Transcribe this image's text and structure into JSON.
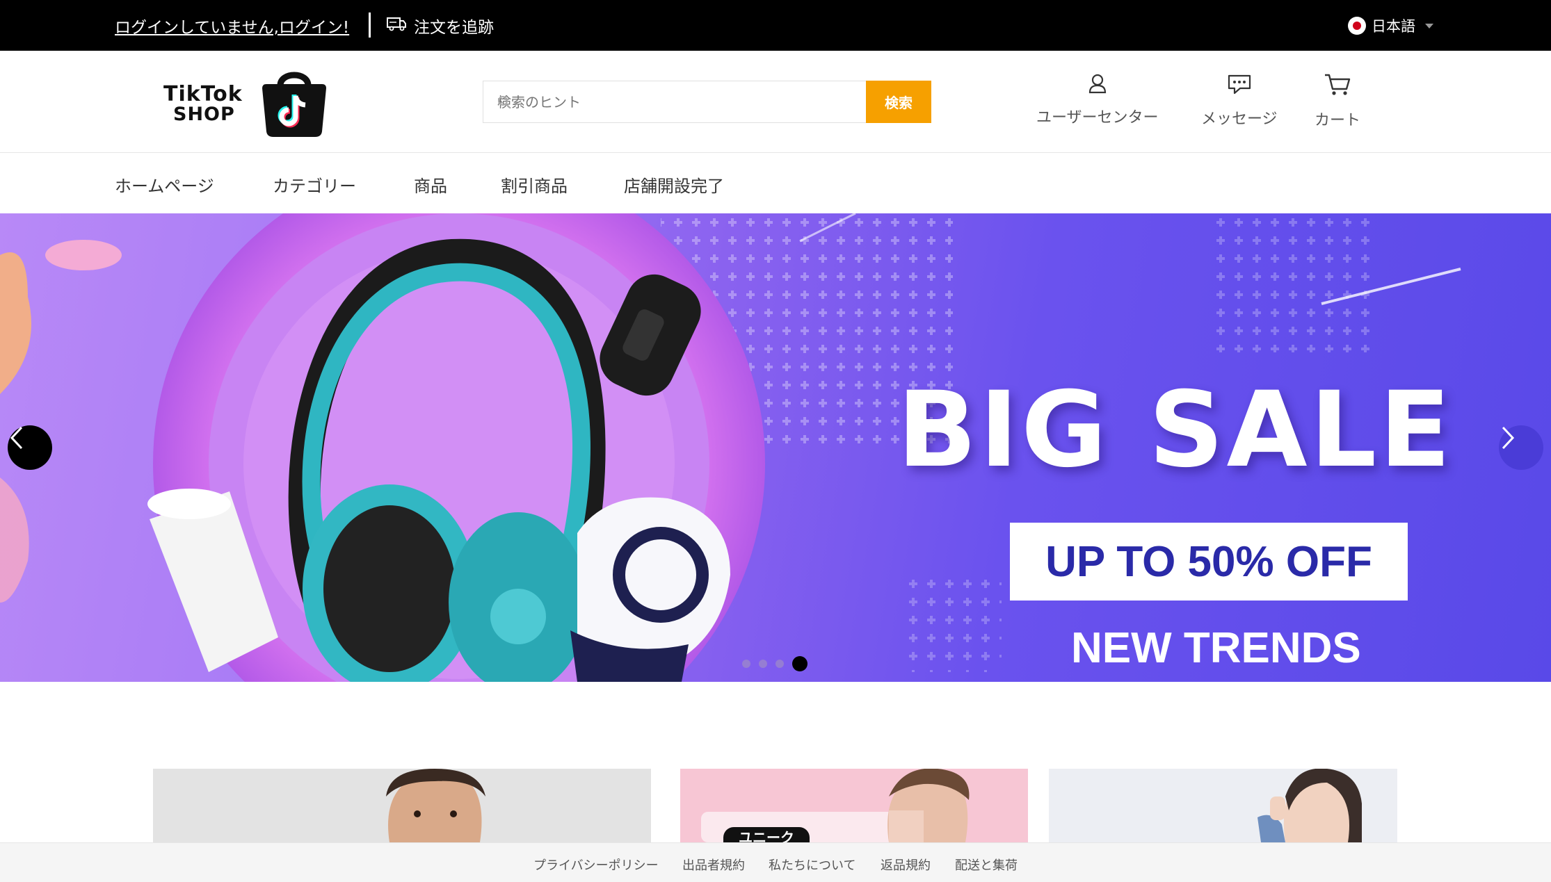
{
  "topbar": {
    "login_text": "ログインしていません,ログイン!",
    "track_order": "注文を追跡",
    "language": "日本語"
  },
  "logo": {
    "line1": "TikTok",
    "line2": "SHOP"
  },
  "search": {
    "placeholder": "検索のヒント",
    "button": "検索"
  },
  "header_links": {
    "user_center": "ユーザーセンター",
    "messages": "メッセージ",
    "cart": "カート"
  },
  "nav": [
    "ホームページ",
    "カテゴリー",
    "商品",
    "割引商品",
    "店舗開設完了"
  ],
  "banner": {
    "headline": "BIG SALE",
    "offer": "UP TO 50% OFF",
    "subline": "NEW TRENDS",
    "slide_count": 4,
    "active_slide": 4
  },
  "cards": {
    "card2_badge": "ユニーク"
  },
  "footer": [
    "プライバシーポリシー",
    "出品者規約",
    "私たちについて",
    "返品規約",
    "配送と集荷"
  ],
  "colors": {
    "topbar": "#000000",
    "search_button": "#f6a000",
    "banner_start": "#b889f7",
    "banner_end": "#5949e8",
    "offer_text": "#2a2aa8"
  }
}
